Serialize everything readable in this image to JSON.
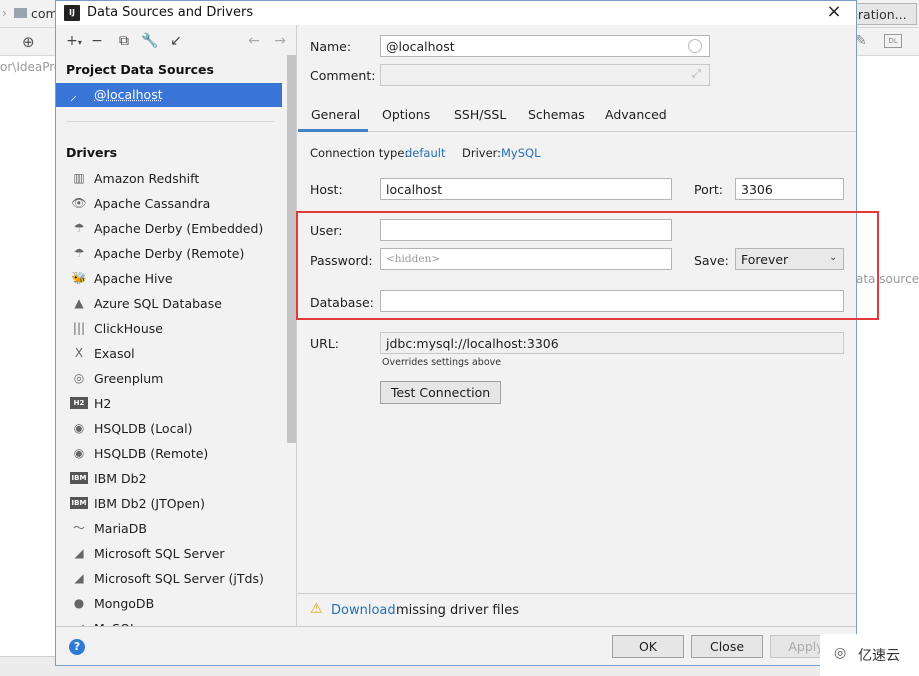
{
  "background": {
    "tab_label": "com",
    "path_text": "or\\IdeaPro",
    "config_button": "uration...",
    "side_text": "ata source"
  },
  "dialog": {
    "title": "Data Sources and Drivers",
    "title_icon": "IJ",
    "close_icon": "×",
    "left": {
      "project_header": "Project Data Sources",
      "selected_source": "@localhost",
      "drivers_header": "Drivers",
      "drivers": [
        {
          "label": "Amazon Redshift",
          "icon": "▥"
        },
        {
          "label": "Apache Cassandra",
          "icon": "👁"
        },
        {
          "label": "Apache Derby (Embedded)",
          "icon": "☂"
        },
        {
          "label": "Apache Derby (Remote)",
          "icon": "☂"
        },
        {
          "label": "Apache Hive",
          "icon": "🐝"
        },
        {
          "label": "Azure SQL Database",
          "icon": "▲"
        },
        {
          "label": "ClickHouse",
          "icon": "|||"
        },
        {
          "label": "Exasol",
          "icon": "X"
        },
        {
          "label": "Greenplum",
          "icon": "◎"
        },
        {
          "label": "H2",
          "icon": "H2"
        },
        {
          "label": "HSQLDB (Local)",
          "icon": "◉"
        },
        {
          "label": "HSQLDB (Remote)",
          "icon": "◉"
        },
        {
          "label": "IBM Db2",
          "icon": "IBM"
        },
        {
          "label": "IBM Db2 (JTOpen)",
          "icon": "IBM"
        },
        {
          "label": "MariaDB",
          "icon": "〜"
        },
        {
          "label": "Microsoft SQL Server",
          "icon": "◢"
        },
        {
          "label": "Microsoft SQL Server (jTds)",
          "icon": "◢"
        },
        {
          "label": "MongoDB",
          "icon": "●"
        },
        {
          "label": "MySQL",
          "icon": "◢"
        }
      ]
    },
    "right": {
      "name_label": "Name:",
      "name_value": "@localhost",
      "comment_label": "Comment:",
      "comment_value": "",
      "tabs": [
        "General",
        "Options",
        "SSH/SSL",
        "Schemas",
        "Advanced"
      ],
      "conn_type_label": "Connection type:",
      "conn_type_value": "default",
      "driver_label": "Driver:",
      "driver_value": "MySQL",
      "host_label": "Host:",
      "host_value": "localhost",
      "port_label": "Port:",
      "port_value": "3306",
      "user_label": "User:",
      "user_value": "",
      "password_label": "Password:",
      "password_placeholder": "<hidden>",
      "save_label": "Save:",
      "save_value": "Forever",
      "database_label": "Database:",
      "database_value": "",
      "url_label": "URL:",
      "url_value": "jdbc:mysql://localhost:3306",
      "url_hint": "Overrides settings above",
      "test_button": "Test Connection",
      "warning_link": "Download",
      "warning_text": " missing driver files"
    },
    "footer": {
      "ok": "OK",
      "close": "Close",
      "apply": "Apply",
      "help": "?"
    }
  },
  "watermark": "亿速云",
  "colors": {
    "selection": "#3875d7",
    "link": "#2470b3",
    "highlight": "#e23a3a",
    "tab_underline": "#4083c9"
  }
}
